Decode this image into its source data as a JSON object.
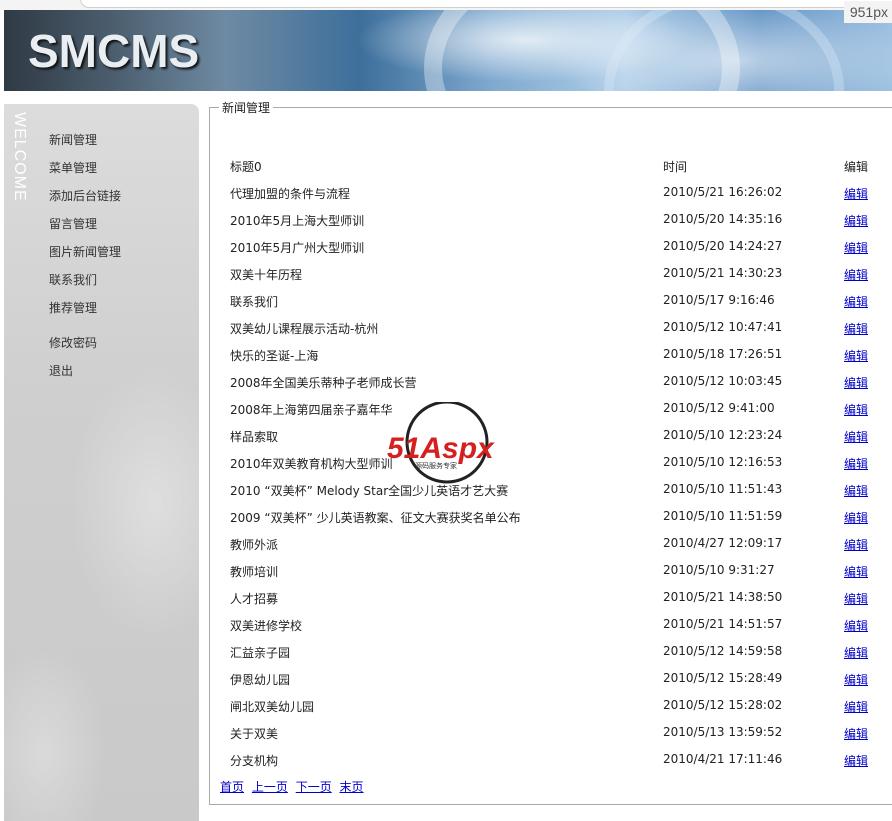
{
  "header": {
    "logo": "SMCMS",
    "width_badge": "951px"
  },
  "sidebar": {
    "welcome": "WELCOME",
    "items": [
      {
        "label": "新闻管理"
      },
      {
        "label": "菜单管理"
      },
      {
        "label": "添加后台链接"
      },
      {
        "label": "留言管理"
      },
      {
        "label": "图片新闻管理"
      },
      {
        "label": "联系我们"
      },
      {
        "label": "推荐管理"
      },
      {
        "label": "修改密码"
      },
      {
        "label": "退出"
      }
    ]
  },
  "main": {
    "legend": "新闻管理",
    "columns": {
      "title": "标题0",
      "time": "时间",
      "edit": "编辑"
    },
    "rows": [
      {
        "title": "代理加盟的条件与流程",
        "time": "2010/5/21 16:26:02",
        "edit": "编辑"
      },
      {
        "title": "2010年5月上海大型师训",
        "time": "2010/5/20 14:35:16",
        "edit": "编辑"
      },
      {
        "title": "2010年5月广州大型师训",
        "time": "2010/5/20 14:24:27",
        "edit": "编辑"
      },
      {
        "title": "双美十年历程",
        "time": "2010/5/21 14:30:23",
        "edit": "编辑"
      },
      {
        "title": "联系我们",
        "time": "2010/5/17 9:16:46",
        "edit": "编辑"
      },
      {
        "title": "双美幼儿课程展示活动-杭州",
        "time": "2010/5/12 10:47:41",
        "edit": "编辑"
      },
      {
        "title": "快乐的圣诞-上海",
        "time": "2010/5/18 17:26:51",
        "edit": "编辑"
      },
      {
        "title": "2008年全国美乐蒂种子老师成长营",
        "time": "2010/5/12 10:03:45",
        "edit": "编辑"
      },
      {
        "title": "2008年上海第四届亲子嘉年华",
        "time": "2010/5/12 9:41:00",
        "edit": "编辑"
      },
      {
        "title": "样品索取",
        "time": "2010/5/10 12:23:24",
        "edit": "编辑"
      },
      {
        "title": "2010年双美教育机构大型师训",
        "time": "2010/5/10 12:16:53",
        "edit": "编辑"
      },
      {
        "title": "2010 “双美杯” Melody Star全国少儿英语才艺大赛",
        "time": "2010/5/10 11:51:43",
        "edit": "编辑"
      },
      {
        "title": "2009 “双美杯” 少儿英语教案、征文大赛获奖名单公布",
        "time": "2010/5/10 11:51:59",
        "edit": "编辑"
      },
      {
        "title": "教师外派",
        "time": "2010/4/27 12:09:17",
        "edit": "编辑"
      },
      {
        "title": "教师培训",
        "time": "2010/5/10 9:31:27",
        "edit": "编辑"
      },
      {
        "title": "人才招募",
        "time": "2010/5/21 14:38:50",
        "edit": "编辑"
      },
      {
        "title": "双美进修学校",
        "time": "2010/5/21 14:51:57",
        "edit": "编辑"
      },
      {
        "title": "汇益亲子园",
        "time": "2010/5/12 14:59:58",
        "edit": "编辑"
      },
      {
        "title": "伊恩幼儿园",
        "time": "2010/5/12 15:28:49",
        "edit": "编辑"
      },
      {
        "title": "闸北双美幼儿园",
        "time": "2010/5/12 15:28:02",
        "edit": "编辑"
      },
      {
        "title": "关于双美",
        "time": "2010/5/13 13:59:52",
        "edit": "编辑"
      },
      {
        "title": "分支机构",
        "time": "2010/4/21 17:11:46",
        "edit": "编辑"
      }
    ],
    "pager": {
      "first": "首页",
      "prev": "上一页",
      "next": "下一页",
      "last": "末页"
    }
  },
  "watermark": {
    "brand": "51Aspx",
    "tagline": "源码服务专家"
  }
}
